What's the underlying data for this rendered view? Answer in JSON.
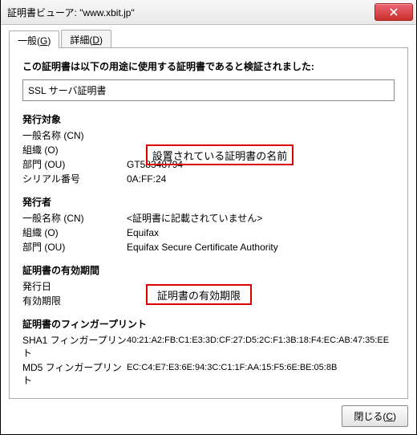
{
  "window": {
    "title": "証明書ビューア: \"www.xbit.jp\""
  },
  "tabs": {
    "general": "一般(",
    "general_u": "G",
    "general2": ")",
    "detail": "詳細(",
    "detail_u": "D",
    "detail2": ")"
  },
  "headline": "この証明書は以下の用途に使用する証明書であると検証されました:",
  "certtype": "SSL サーバ証明書",
  "annotations": {
    "name": "設置されている証明書の名前",
    "validity": "証明書の有効期限"
  },
  "subject": {
    "heading": "発行対象",
    "cn_label": "一般名称 (CN)",
    "cn_value": "",
    "o_label": "組織 (O)",
    "o_value": "",
    "ou_label": "部門 (OU)",
    "ou_value": "GT58348794",
    "serial_label": "シリアル番号",
    "serial_value": "0A:FF:24"
  },
  "issuer": {
    "heading": "発行者",
    "cn_label": "一般名称 (CN)",
    "cn_value": "<証明書に記載されていません>",
    "o_label": "組織 (O)",
    "o_value": "Equifax",
    "ou_label": "部門 (OU)",
    "ou_value": "Equifax Secure Certificate Authority"
  },
  "validity": {
    "heading": "証明書の有効期間",
    "from_label": "発行日",
    "from_value": "",
    "to_label": "有効期限",
    "to_value": ""
  },
  "fingerprints": {
    "heading": "証明書のフィンガープリント",
    "sha1_label": "SHA1 フィンガープリント",
    "sha1_value": "40:21:A2:FB:C1:E3:3D:CF:27:D5:2C:F1:3B:18:F4:EC:AB:47:35:EE",
    "md5_label": "MD5 フィンガープリント",
    "md5_value": "EC:C4:E7:E3:6E:94:3C:C1:1F:AA:15:F5:6E:BE:05:8B"
  },
  "buttons": {
    "close": "閉じる(",
    "close_u": "C",
    "close2": ")"
  }
}
